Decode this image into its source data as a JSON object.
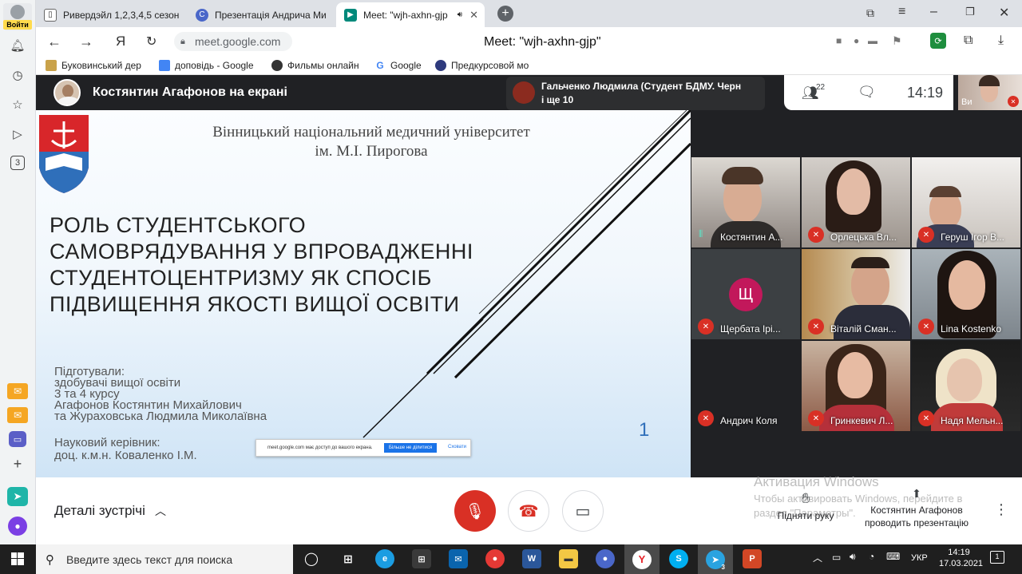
{
  "browser": {
    "login_label": "Войти",
    "tabs": [
      {
        "title": "Ривердэйл 1,2,3,4,5 сезон"
      },
      {
        "title": "Презентація Андрича Ми"
      },
      {
        "title": "Meet: \"wjh-axhn-gjp"
      }
    ],
    "url": "meet.google.com",
    "page_title": "Meet: \"wjh-axhn-gjp\"",
    "yandex_glyph": "Я",
    "rail_badge": "3",
    "bookmarks": [
      "Буковинський дер",
      "доповідь - Google",
      "Фильмы онлайн",
      "Google",
      "Предкурсовой мо"
    ]
  },
  "meet": {
    "presenter_banner": "Костянтин Агафонов на екрані",
    "notification": {
      "line1": "Гальченко Людмила (Студент БДМУ. Черн",
      "line2": "і ще 10"
    },
    "people_count": "22",
    "time": "14:19",
    "self_label": "Ви",
    "slide": {
      "university": "Вінницький національний медичний університет",
      "university2": "ім. М.І. Пирогова",
      "title": [
        "РОЛЬ СТУДЕНТСЬКОГО",
        "САМОВРЯДУВАННЯ У ВПРОВАДЖЕННІ",
        "СТУДЕНТОЦЕНТРИЗМУ ЯК СПОСІБ",
        "ПІДВИЩЕННЯ ЯКОСТІ ВИЩОЇ ОСВІТИ"
      ],
      "prepared": [
        "Підготували:",
        "здобувачі вищої освіти",
        "3 та 4 курсу",
        "Агафонов Костянтин Михайлович",
        "та Жураховська Людмила Миколаївна"
      ],
      "supervisor": [
        "Науковий керівник:",
        "доц. к.м.н. Коваленко І.М."
      ],
      "page_number": "1",
      "share_notice": "meet.google.com має доступ до вашого екрана.",
      "share_stop": "Більше не ділитися",
      "share_hide": "Сховати"
    },
    "participants": [
      {
        "name": "Костянтин А...",
        "muted": false
      },
      {
        "name": "Орлецька Вл...",
        "muted": true
      },
      {
        "name": "Геруш Ігор В...",
        "muted": true
      },
      {
        "name": "Щербата Ірі...",
        "muted": true,
        "initial": "Щ"
      },
      {
        "name": "Віталій Сман...",
        "muted": true
      },
      {
        "name": "Lina Kostenko",
        "muted": true
      },
      {
        "name": "Андрич Коля",
        "muted": true
      },
      {
        "name": "Гринкевич Л...",
        "muted": true
      },
      {
        "name": "Надя Мельн...",
        "muted": true
      }
    ],
    "meeting_details": "Деталі зустрічі",
    "raise_hand": "Підняти руку",
    "presenting_line1": "Костянтин Агафонов",
    "presenting_line2": "проводить презентацію",
    "windows_activation_title": "Активация Windows",
    "windows_activation_line1": "Чтобы активировать Windows, перейдите в",
    "windows_activation_line2": "раздел \"Параметры\"."
  },
  "taskbar": {
    "search_placeholder": "Введите здесь текст для поиска",
    "lang": "УКР",
    "time": "14:19",
    "date": "17.03.2021",
    "notif_count": "1",
    "telegram_badge": "3"
  }
}
